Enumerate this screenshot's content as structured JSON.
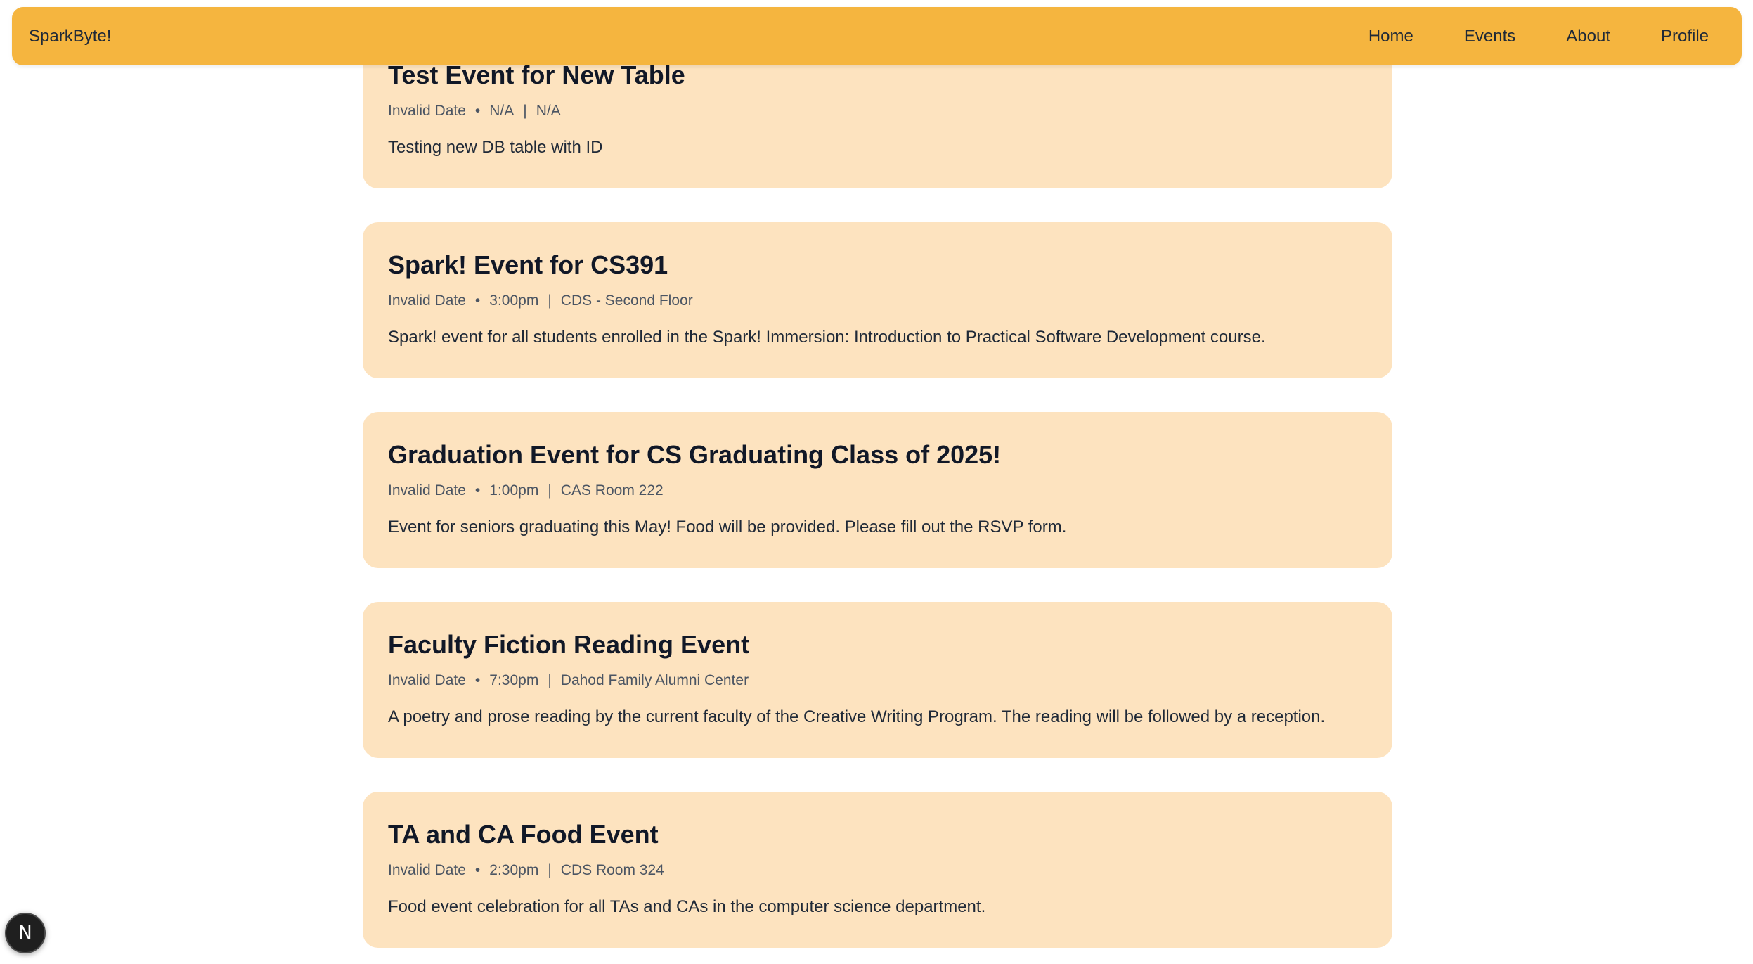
{
  "navbar": {
    "brand": "SparkByte!",
    "links": [
      "Home",
      "Events",
      "About",
      "Profile"
    ]
  },
  "events": [
    {
      "title": "Test Event for New Table",
      "date": "Invalid Date",
      "time": "N/A",
      "location": "N/A",
      "description": "Testing new DB table with ID"
    },
    {
      "title": "Spark! Event for CS391",
      "date": "Invalid Date",
      "time": "3:00pm",
      "location": "CDS - Second Floor",
      "description": "Spark! event for all students enrolled in the Spark! Immersion: Introduction to Practical Software Development course."
    },
    {
      "title": "Graduation Event for CS Graduating Class of 2025!",
      "date": "Invalid Date",
      "time": "1:00pm",
      "location": "CAS Room 222",
      "description": "Event for seniors graduating this May! Food will be provided. Please fill out the RSVP form."
    },
    {
      "title": "Faculty Fiction Reading Event",
      "date": "Invalid Date",
      "time": "7:30pm",
      "location": "Dahod Family Alumni Center",
      "description": "A poetry and prose reading by the current faculty of the Creative Writing Program. The reading will be followed by a reception."
    },
    {
      "title": "TA and CA Food Event",
      "date": "Invalid Date",
      "time": "2:30pm",
      "location": "CDS Room 324",
      "description": "Food event celebration for all TAs and CAs in the computer science department."
    }
  ],
  "meta_separators": {
    "dot": "•",
    "bar": "|"
  },
  "dev_badge": {
    "letter": "N",
    "icon": "nextjs-logo-icon"
  },
  "colors": {
    "navbar": "#f5b53f",
    "card": "#fde3bf",
    "badge": "#1f1f1f"
  }
}
